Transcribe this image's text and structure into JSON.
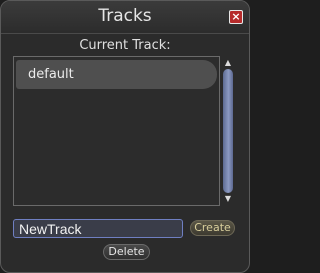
{
  "window": {
    "title": "Tracks",
    "close_glyph": "×"
  },
  "tracks": {
    "label": "Current Track:",
    "items": [
      {
        "label": "default",
        "selected": true
      }
    ]
  },
  "scroll": {
    "up_glyph": "▲",
    "down_glyph": "▼"
  },
  "new_track": {
    "value": "NewTrack",
    "create_label": "Create"
  },
  "actions": {
    "delete_label": "Delete"
  },
  "colors": {
    "close_button": "#b62b2b",
    "input_border": "#6f7fc2",
    "scroll_thumb": "#8c9ac2",
    "create_text": "#d8ce9c"
  }
}
